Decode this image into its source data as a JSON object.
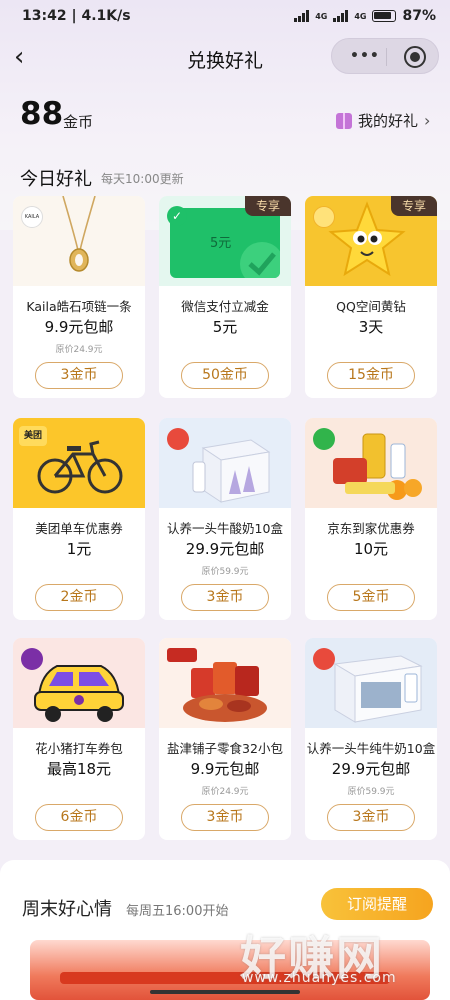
{
  "status_bar": {
    "time": "13:42",
    "speed": "4.1K/s",
    "net1": "4G",
    "net2": "4G",
    "battery": "87%"
  },
  "nav": {
    "title": "兑换好礼",
    "more_icon": "more-dots-icon",
    "target_icon": "target-icon"
  },
  "balance": {
    "amount": "88",
    "unit": "金币",
    "my_gifts": "我的好礼"
  },
  "section": {
    "title": "今日好礼",
    "subtitle": "每天10:00更新"
  },
  "products": [
    {
      "name": "Kaila皓石项链一条",
      "price": "9.9元包邮",
      "original": "原价24.9元",
      "cost": "3金币",
      "badge": "",
      "logo": "KAILA",
      "img_text": ""
    },
    {
      "name": "微信支付立减金",
      "price": "5元",
      "original": "",
      "cost": "50金币",
      "badge": "专享",
      "logo": "",
      "img_text": "5元"
    },
    {
      "name": "QQ空间黄钻",
      "price": "3天",
      "original": "",
      "cost": "15金币",
      "badge": "专享",
      "logo": "",
      "img_text": ""
    },
    {
      "name": "美团单车优惠券",
      "price": "1元",
      "original": "",
      "cost": "2金币",
      "badge": "",
      "logo": "美团",
      "img_text": ""
    },
    {
      "name": "认养一头牛酸奶10盒",
      "price": "29.9元包邮",
      "original": "原价59.9元",
      "cost": "3金币",
      "badge": "",
      "logo": "",
      "img_text": ""
    },
    {
      "name": "京东到家优惠券",
      "price": "10元",
      "original": "",
      "cost": "5金币",
      "badge": "",
      "logo": "",
      "img_text": ""
    },
    {
      "name": "花小猪打车券包",
      "price": "最高18元",
      "original": "",
      "cost": "6金币",
      "badge": "",
      "logo": "",
      "img_text": ""
    },
    {
      "name": "盐津铺子零食32小包",
      "price": "9.9元包邮",
      "original": "原价24.9元",
      "cost": "3金币",
      "badge": "",
      "logo": "",
      "img_text": ""
    },
    {
      "name": "认养一头牛纯牛奶10盒",
      "price": "29.9元包邮",
      "original": "原价59.9元",
      "cost": "3金币",
      "badge": "",
      "logo": "",
      "img_text": ""
    }
  ],
  "weekend": {
    "title": "周末好心情",
    "subtitle": "每周五16:00开始",
    "subscribe": "订阅提醒"
  },
  "watermark": {
    "big": "好赚网",
    "small": "www.zhuanyes.com"
  }
}
